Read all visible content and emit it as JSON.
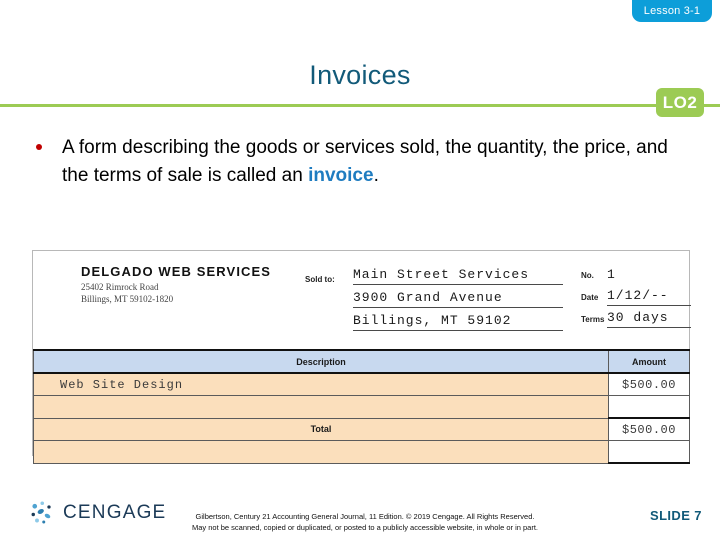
{
  "lesson_tab": {
    "label": "Lesson 3-1"
  },
  "title": "Invoices",
  "learning_objective": {
    "badge": "LO2"
  },
  "bullet": {
    "text_before": "A form describing the goods or services sold, the quantity, the price, and the terms of sale is called an ",
    "keyword": "invoice",
    "text_after": "."
  },
  "invoice": {
    "company": "DELGADO WEB SERVICES",
    "address_line1": "25402 Rimrock Road",
    "address_line2": "Billings, MT 59102-1820",
    "sold_to_label": "Sold to:",
    "sold_to_lines": [
      "Main Street Services",
      "3900 Grand Avenue",
      "Billings, MT  59102"
    ],
    "meta": [
      {
        "label": "No.",
        "value": "1",
        "ruled": false
      },
      {
        "label": "Date",
        "value": "1/12/--",
        "ruled": true
      },
      {
        "label": "Terms",
        "value": "30 days",
        "ruled": true
      }
    ],
    "table": {
      "headers": {
        "description": "Description",
        "amount": "Amount"
      },
      "rows": [
        {
          "description": "Web Site Design",
          "amount": "$500.00"
        },
        {
          "description": "",
          "amount": ""
        }
      ],
      "total": {
        "label": "Total",
        "amount": "$500.00"
      },
      "trailing_row": {
        "description": "",
        "amount": ""
      }
    }
  },
  "footer": {
    "logo_text": "CENGAGE",
    "copyright_line1": "Gilbertson, Century 21 Accounting General Journal, 11 Edition. © 2019 Cengage. All Rights Reserved.",
    "copyright_line2": "May not be scanned, copied or duplicated, or posted to a publicly accessible website, in whole or in part.",
    "slide_number": "SLIDE 7"
  },
  "colors": {
    "lesson_tab_blue": "#0d9ed9",
    "title_teal": "#125a79",
    "accent_green": "#9ccb54",
    "keyword_blue": "#1f7cc0",
    "bullet_red": "#c00000",
    "table_header_blue": "#c8d9ef",
    "table_row_peach": "#fbdfbc",
    "logo_navy": "#1b3a57"
  }
}
